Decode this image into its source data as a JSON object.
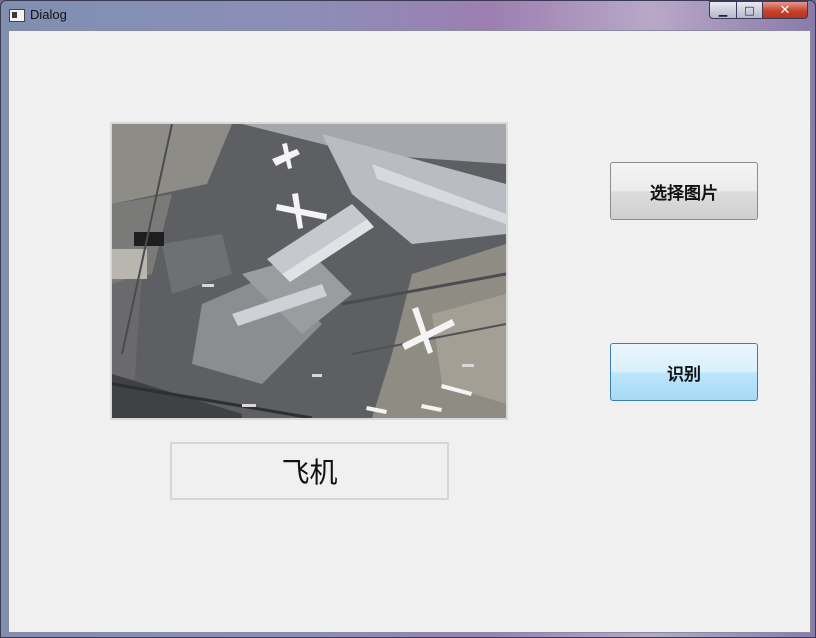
{
  "window": {
    "title": "Dialog",
    "controls": {
      "minimize": "▁",
      "maximize": "□",
      "close": "✕"
    }
  },
  "image_panel": {
    "alt": "aerial airport photo"
  },
  "result": {
    "text": "飞机"
  },
  "buttons": {
    "select_image": "选择图片",
    "recognize": "识别"
  }
}
